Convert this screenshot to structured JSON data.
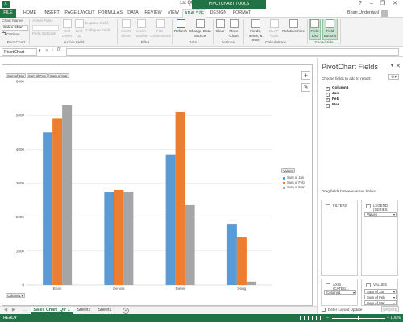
{
  "window": {
    "title": "1st Qtr Sales - Excel",
    "tool_tab": "PIVOTCHART TOOLS",
    "controls": [
      "?",
      "–",
      "❐",
      "✕"
    ]
  },
  "tabs": [
    "FILE",
    "HOME",
    "INSERT",
    "PAGE LAYOUT",
    "FORMULAS",
    "DATA",
    "REVIEW",
    "VIEW",
    "ANALYZE",
    "DESIGN",
    "FORMAT"
  ],
  "active_tab": "ANALYZE",
  "user": "Brian Underdahl",
  "ribbon": {
    "chart_name_label": "Chart Name:",
    "chart_name_value": "Sales Chart Q",
    "options_label": "Options",
    "active_field_label": "Active Field:",
    "field_settings_label": "Field Settings",
    "drill_down": "Drill Down",
    "drill_up": "Drill Up",
    "expand_field": "Expand Field",
    "collapse_field": "Collapse Field",
    "insert_slicer": "Insert Slicer",
    "insert_timeline": "Insert Timeline",
    "filter_connections": "Filter Connections",
    "refresh": "Refresh",
    "change_data_source": "Change Data Source",
    "clear": "Clear",
    "move_chart": "Move Chart",
    "fields_items_sets": "Fields, Items, & Sets",
    "olap_tools": "OLAP Tools",
    "relationships": "Relationships",
    "field_list": "Field List",
    "field_buttons": "Field Buttons",
    "groups": {
      "pivotchart": "PivotChart",
      "active_field": "Active Field",
      "filter": "Filter",
      "data": "Data",
      "actions": "Actions",
      "calculations": "Calculations",
      "show_hide": "Show/Hide"
    }
  },
  "formula_bar": {
    "name_box": "PivotChart",
    "fx": "fx",
    "value": ""
  },
  "chart_field_buttons": [
    "Sum of Jan",
    "Sum of Feb",
    "Sum of Mar"
  ],
  "axis_field_button": "Column1",
  "legend_title": "Values",
  "chart_data": {
    "type": "bar",
    "categories": [
      "Brian",
      "Dennis",
      "Dieter",
      "Doug"
    ],
    "series": [
      {
        "name": "Sum of Jan",
        "values": [
          4500,
          2750,
          3850,
          1800
        ]
      },
      {
        "name": "Sum of Feb",
        "values": [
          4900,
          2800,
          5100,
          1400
        ]
      },
      {
        "name": "Sum of Mar",
        "values": [
          5300,
          2750,
          2350,
          100
        ]
      }
    ],
    "colors": [
      "#5b9bd5",
      "#ed7d31",
      "#a5a5a5"
    ],
    "yticks": [
      "0",
      "1000",
      "2000",
      "3000",
      "4000",
      "5000",
      "6000"
    ],
    "ylim": [
      0,
      6000
    ],
    "legend_position": "right",
    "grid": true
  },
  "side_buttons": {
    "add": "+",
    "style": "✎"
  },
  "pane": {
    "title": "PivotChart Fields",
    "subtitle": "Choose fields to add to report:",
    "fields": [
      {
        "label": "Column1",
        "checked": true
      },
      {
        "label": "Jan",
        "checked": true
      },
      {
        "label": "Feb",
        "checked": true
      },
      {
        "label": "Mar",
        "checked": true
      }
    ],
    "drag_text": "Drag fields between areas below:",
    "filters_label": "FILTERS",
    "legend_label": "LEGEND (SERIES)",
    "legend_items": [
      "Values"
    ],
    "axis_label": "AXIS (CATEG...",
    "axis_items": [
      "Column1"
    ],
    "values_label": "VALUES",
    "values_items": [
      "Sum of Jan",
      "Sum of Feb",
      "Sum of Mar"
    ],
    "defer_label": "Defer Layout Update",
    "update_label": "UPDATE"
  },
  "sheet_tabs": [
    "Sales Chart_Qtr 1",
    "Sheet2",
    "Sheet1"
  ],
  "active_sheet": "Sales Chart_Qtr 1",
  "status": {
    "ready": "READY",
    "zoom": "100%"
  }
}
